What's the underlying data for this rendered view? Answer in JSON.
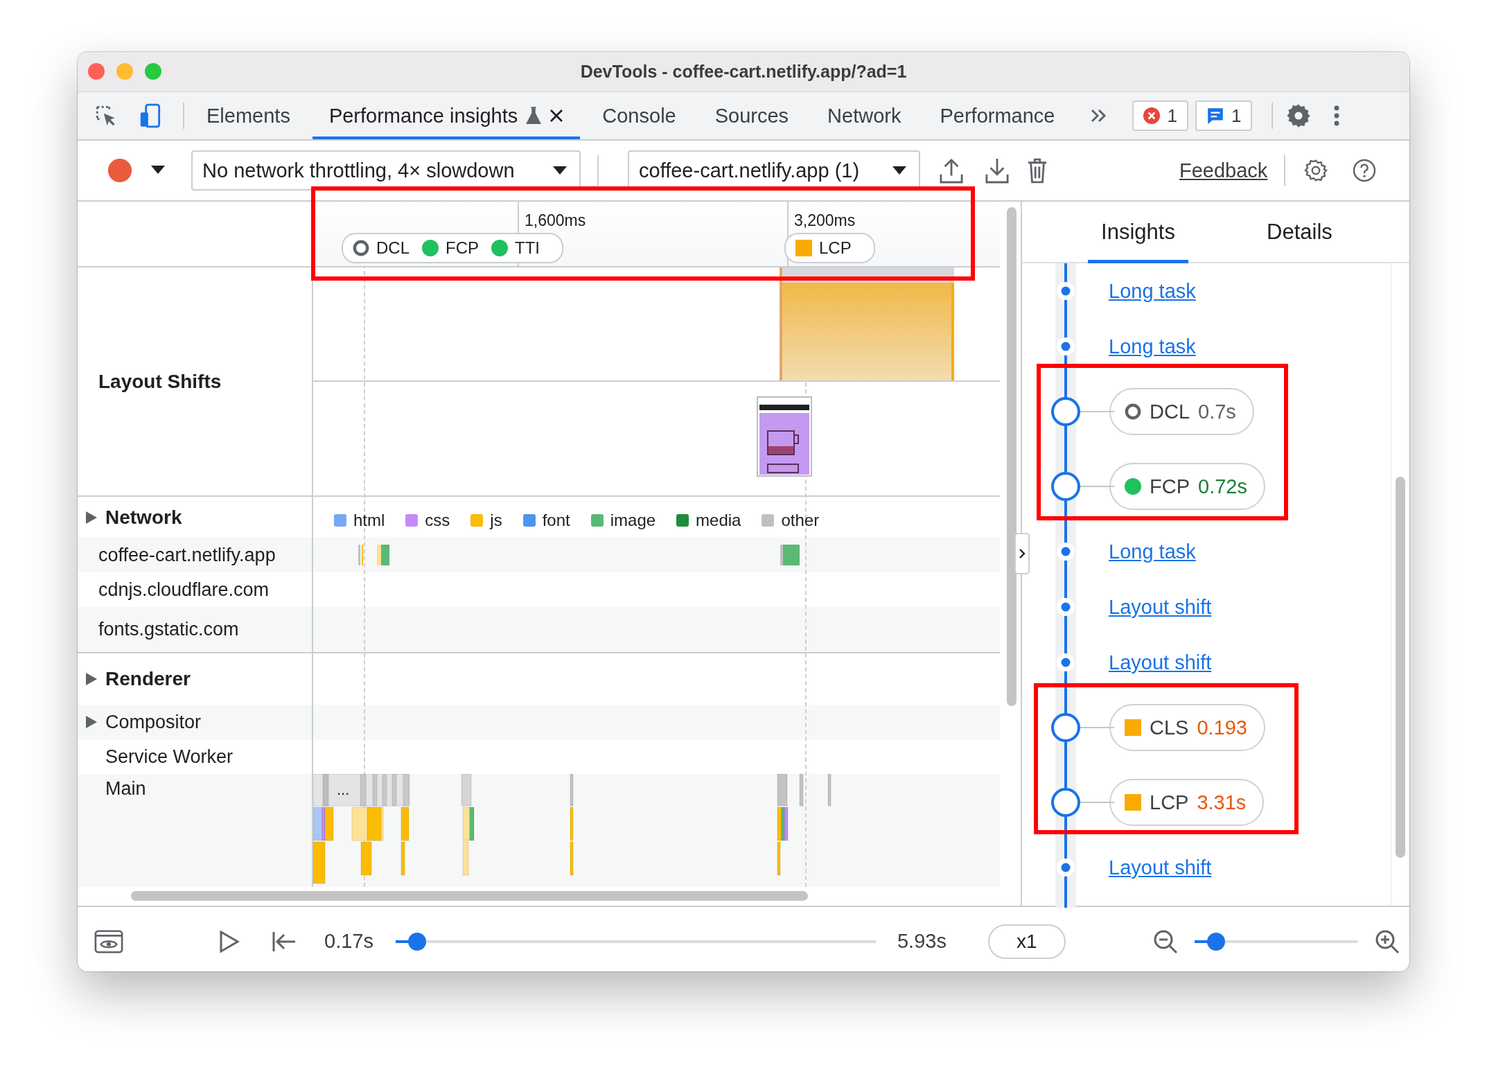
{
  "window": {
    "title": "DevTools - coffee-cart.netlify.app/?ad=1"
  },
  "tabs": [
    {
      "label": "Elements",
      "selected": false,
      "experimental": false,
      "closable": false
    },
    {
      "label": "Performance insights",
      "selected": true,
      "experimental": true,
      "closable": true
    },
    {
      "label": "Console",
      "selected": false,
      "experimental": false,
      "closable": false
    },
    {
      "label": "Sources",
      "selected": false,
      "experimental": false,
      "closable": false
    },
    {
      "label": "Network",
      "selected": false,
      "experimental": false,
      "closable": false
    },
    {
      "label": "Performance",
      "selected": false,
      "experimental": false,
      "closable": false
    }
  ],
  "status_badges": [
    {
      "kind": "error",
      "count": "1"
    },
    {
      "kind": "message",
      "count": "1"
    }
  ],
  "toolbar": {
    "throttling": "No network throttling, 4× slowdown",
    "recording": "coffee-cart.netlify.app (1)",
    "feedback": "Feedback"
  },
  "timeline": {
    "ticks": [
      "1,600ms",
      "3,200ms"
    ],
    "marker_groups": [
      {
        "markers": [
          {
            "label": "DCL",
            "kind": "ring"
          },
          {
            "label": "FCP",
            "kind": "dot"
          },
          {
            "label": "TTI",
            "kind": "dot"
          }
        ]
      },
      {
        "markers": [
          {
            "label": "LCP",
            "kind": "square"
          }
        ]
      }
    ],
    "layout_shifts": {
      "label": "Layout Shifts"
    },
    "network": {
      "label": "Network",
      "expanded": false,
      "legend": [
        {
          "label": "html",
          "color": "#78a8f3"
        },
        {
          "label": "css",
          "color": "#c58af9"
        },
        {
          "label": "js",
          "color": "#fbbc04"
        },
        {
          "label": "font",
          "color": "#4e95f0"
        },
        {
          "label": "image",
          "color": "#5bb974"
        },
        {
          "label": "media",
          "color": "#1e8e3e"
        },
        {
          "label": "other",
          "color": "#bdc1c6"
        }
      ],
      "hosts": [
        "coffee-cart.netlify.app",
        "cdnjs.cloudflare.com",
        "fonts.gstatic.com"
      ]
    },
    "renderer": {
      "label": "Renderer",
      "expanded": false
    },
    "threads": [
      {
        "label": "Compositor",
        "expandable": true
      },
      {
        "label": "Service Worker",
        "expandable": false
      },
      {
        "label": "Main",
        "expandable": false,
        "collapsed_label": "..."
      }
    ]
  },
  "insights": {
    "tabs": [
      {
        "label": "Insights",
        "selected": true
      },
      {
        "label": "Details",
        "selected": false
      }
    ],
    "items": [
      {
        "kind": "link",
        "label": "Long task"
      },
      {
        "kind": "link",
        "label": "Long task"
      },
      {
        "kind": "ring",
        "label": "DCL",
        "value": "0.7s",
        "color": "#5f6368"
      },
      {
        "kind": "dot",
        "label": "FCP",
        "value": "0.72s",
        "color": "#188038"
      },
      {
        "kind": "link",
        "label": "Long task"
      },
      {
        "kind": "link",
        "label": "Layout shift"
      },
      {
        "kind": "link",
        "label": "Layout shift"
      },
      {
        "kind": "square",
        "label": "CLS",
        "value": "0.193",
        "color": "#e8590a"
      },
      {
        "kind": "square",
        "label": "LCP",
        "value": "3.31s",
        "color": "#e8590a"
      },
      {
        "kind": "link",
        "label": "Layout shift"
      }
    ]
  },
  "footer": {
    "start": "0.17s",
    "end": "5.93s",
    "playhead": {
      "level": 0.045
    },
    "speed": "x1",
    "zoom": {
      "level": 0.13
    }
  }
}
